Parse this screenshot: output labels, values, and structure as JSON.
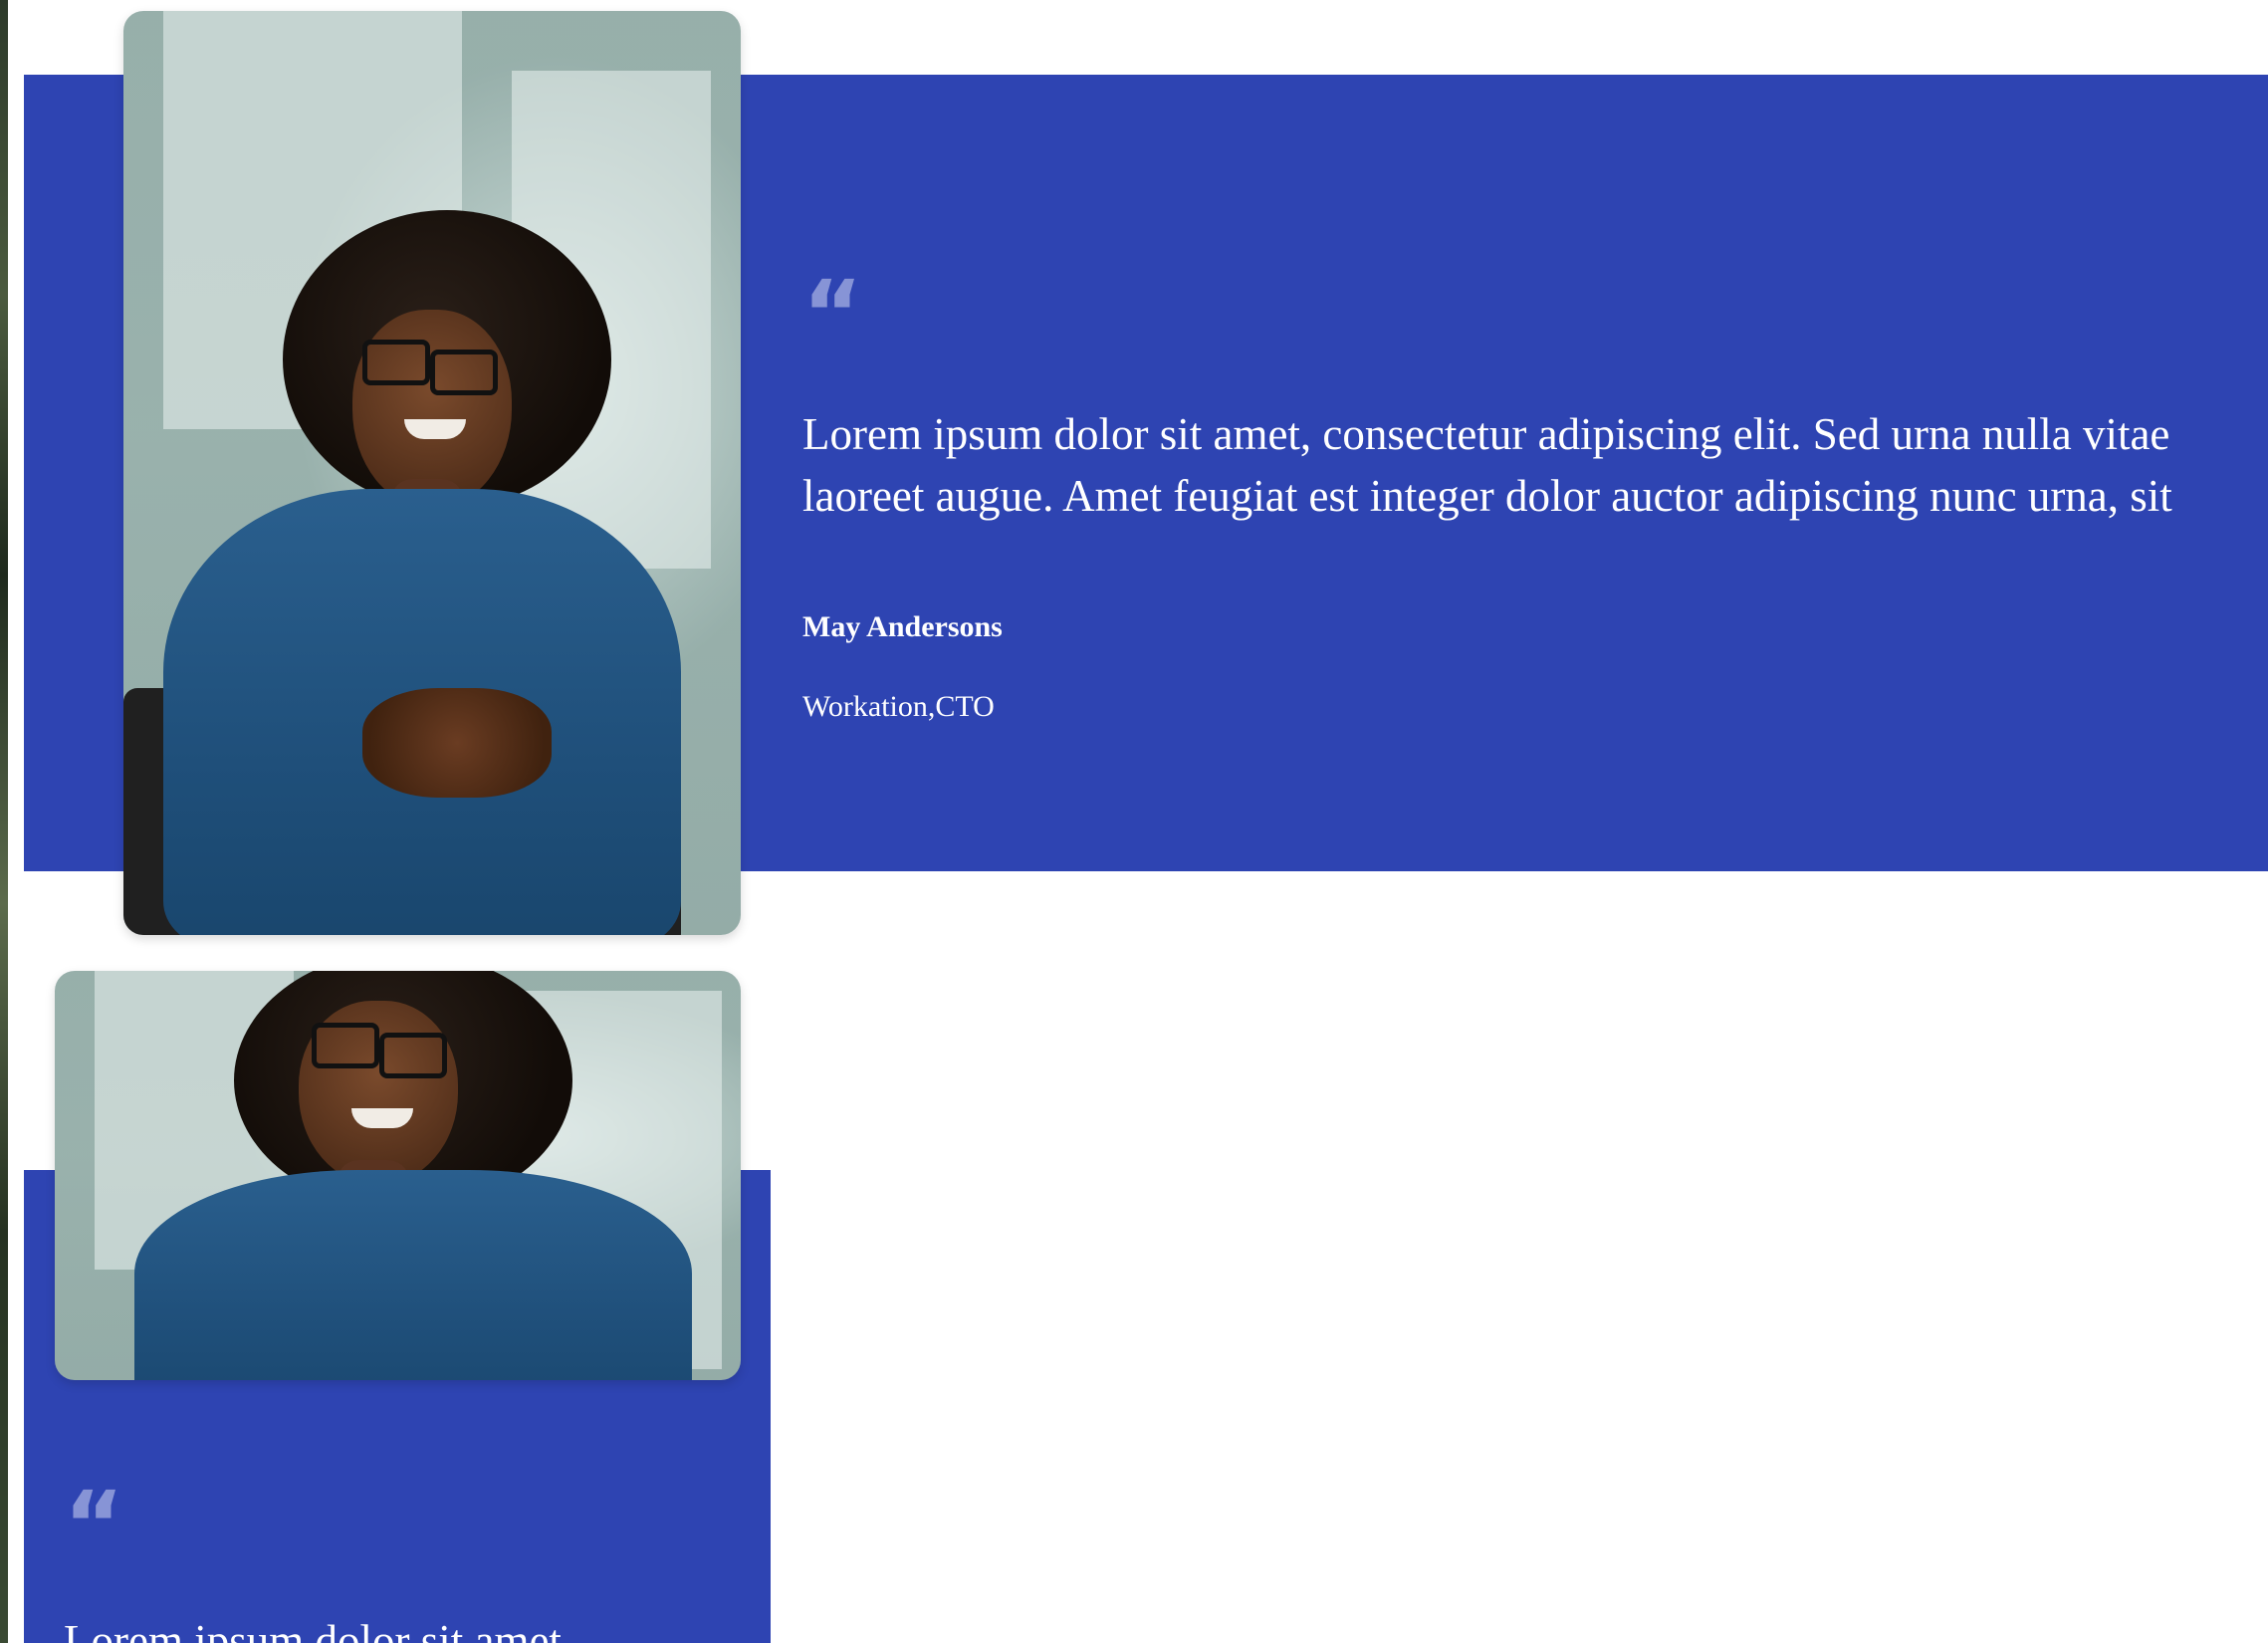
{
  "colors": {
    "band": "#2e44b2",
    "quote_icon": "#8794d6",
    "text": "#ffffff"
  },
  "testimonials": [
    {
      "photo_alt": "woman-in-blue-dress-portrait",
      "quote_icon": "“",
      "quote_lines": [
        "Lorem ipsum dolor sit amet, consectetur adipiscing elit. Sed urna nulla vitae",
        "laoreet augue. Amet feugiat est integer dolor auctor adipiscing nunc urna, sit"
      ],
      "name": "May Andersons",
      "role": "Workation,CTO"
    },
    {
      "photo_alt": "woman-in-blue-dress-portrait",
      "quote_icon": "“",
      "quote_lines": [
        "Lorem ipsum dolor sit amet,"
      ]
    }
  ]
}
